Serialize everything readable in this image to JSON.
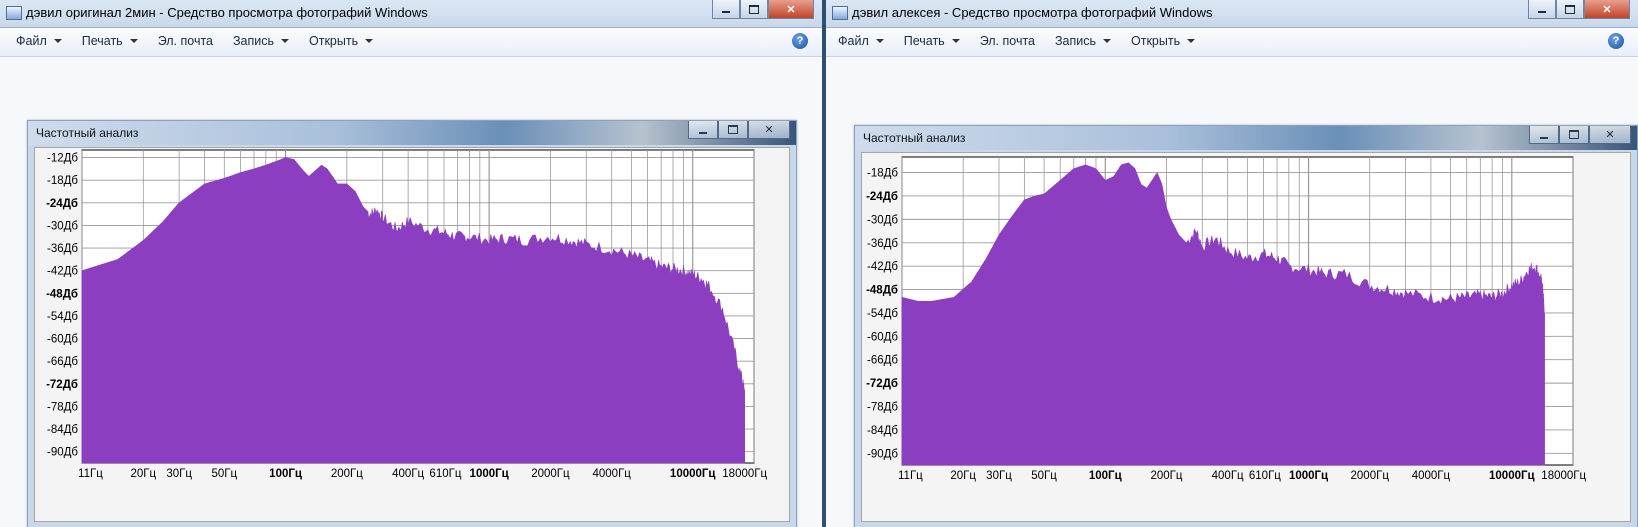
{
  "left_window": {
    "title": "дэвил оригинал 2мин - Средство просмотра фотографий Windows",
    "menu": [
      {
        "label": "Файл",
        "dropdown": true
      },
      {
        "label": "Печать",
        "dropdown": true
      },
      {
        "label": "Эл. почта",
        "dropdown": false
      },
      {
        "label": "Запись",
        "dropdown": true
      },
      {
        "label": "Открыть",
        "dropdown": true
      }
    ],
    "help": "?",
    "dialog_title": "Частотный анализ"
  },
  "right_window": {
    "title": "дэвил алексея - Средство просмотра фотографий Windows",
    "menu": [
      {
        "label": "Файл",
        "dropdown": true
      },
      {
        "label": "Печать",
        "dropdown": true
      },
      {
        "label": "Эл. почта",
        "dropdown": false
      },
      {
        "label": "Запись",
        "dropdown": true
      },
      {
        "label": "Открыть",
        "dropdown": true
      }
    ],
    "help": "?",
    "dialog_title": "Частотный анализ"
  },
  "colors": {
    "fill": "#8b3fc0",
    "grid": "#9a9a9a",
    "plot_bg": "#ffffff"
  },
  "chart_data": [
    {
      "type": "area",
      "title": "",
      "xscale": "log",
      "xlabel": "",
      "ylabel": "",
      "yticks": [
        {
          "label": "-12Дб",
          "value": -12,
          "bold": false
        },
        {
          "label": "-18Дб",
          "value": -18,
          "bold": false
        },
        {
          "label": "-24Дб",
          "value": -24,
          "bold": true
        },
        {
          "label": "-30Дб",
          "value": -30,
          "bold": false
        },
        {
          "label": "-36Дб",
          "value": -36,
          "bold": false
        },
        {
          "label": "-42Дб",
          "value": -42,
          "bold": false
        },
        {
          "label": "-48Дб",
          "value": -48,
          "bold": true
        },
        {
          "label": "-54Дб",
          "value": -54,
          "bold": false
        },
        {
          "label": "-60Дб",
          "value": -60,
          "bold": false
        },
        {
          "label": "-66Дб",
          "value": -66,
          "bold": false
        },
        {
          "label": "-72Дб",
          "value": -72,
          "bold": true
        },
        {
          "label": "-78Дб",
          "value": -78,
          "bold": false
        },
        {
          "label": "-84Дб",
          "value": -84,
          "bold": false
        },
        {
          "label": "-90Дб",
          "value": -90,
          "bold": false
        }
      ],
      "xticks": [
        {
          "label": "11Гц",
          "value": 11,
          "bold": false
        },
        {
          "label": "20Гц",
          "value": 20,
          "bold": false
        },
        {
          "label": "30Гц",
          "value": 30,
          "bold": false
        },
        {
          "label": "50Гц",
          "value": 50,
          "bold": false
        },
        {
          "label": "100Гц",
          "value": 100,
          "bold": true
        },
        {
          "label": "200Гц",
          "value": 200,
          "bold": false
        },
        {
          "label": "400Гц",
          "value": 400,
          "bold": false
        },
        {
          "label": "610Гц",
          "value": 610,
          "bold": false
        },
        {
          "label": "1000Гц",
          "value": 1000,
          "bold": true
        },
        {
          "label": "2000Гц",
          "value": 2000,
          "bold": false
        },
        {
          "label": "4000Гц",
          "value": 4000,
          "bold": false
        },
        {
          "label": "10000Гц",
          "value": 10000,
          "bold": true
        },
        {
          "label": "18000Гц",
          "value": 18000,
          "bold": false
        }
      ],
      "xlim": [
        10,
        20000
      ],
      "ylim": [
        -93,
        -10
      ],
      "series": [
        {
          "x": [
            10,
            15,
            20,
            25,
            30,
            40,
            50,
            60,
            70,
            80,
            90,
            95,
            100,
            110,
            120,
            130,
            140,
            150,
            160,
            170,
            180,
            200,
            220,
            240,
            260,
            280,
            300,
            350,
            400,
            500,
            600,
            700,
            800,
            1000,
            1200,
            1500,
            2000,
            2500,
            3000,
            4000,
            5000,
            6000,
            7000,
            8000,
            9000,
            10000,
            11000,
            12000,
            14000,
            16000,
            17500,
            18000
          ],
          "values": [
            -42,
            -39,
            -34,
            -29,
            -24,
            -19,
            -17.5,
            -16,
            -15,
            -14,
            -13,
            -12.5,
            -12,
            -12.5,
            -15,
            -17,
            -15.5,
            -14,
            -15,
            -17,
            -19,
            -19,
            -21,
            -25,
            -27,
            -26,
            -28,
            -31,
            -29,
            -31,
            -32,
            -33,
            -33,
            -34,
            -33.5,
            -34,
            -33,
            -34,
            -35,
            -36.5,
            -38,
            -39.5,
            -41,
            -41.5,
            -42,
            -43,
            -44,
            -46,
            -52,
            -63,
            -71,
            -74
          ]
        }
      ]
    },
    {
      "type": "area",
      "title": "",
      "xscale": "log",
      "xlabel": "",
      "ylabel": "",
      "yticks": [
        {
          "label": "-18Дб",
          "value": -18,
          "bold": false
        },
        {
          "label": "-24Дб",
          "value": -24,
          "bold": true
        },
        {
          "label": "-30Дб",
          "value": -30,
          "bold": false
        },
        {
          "label": "-36Дб",
          "value": -36,
          "bold": false
        },
        {
          "label": "-42Дб",
          "value": -42,
          "bold": false
        },
        {
          "label": "-48Дб",
          "value": -48,
          "bold": true
        },
        {
          "label": "-54Дб",
          "value": -54,
          "bold": false
        },
        {
          "label": "-60Дб",
          "value": -60,
          "bold": false
        },
        {
          "label": "-66Дб",
          "value": -66,
          "bold": false
        },
        {
          "label": "-72Дб",
          "value": -72,
          "bold": true
        },
        {
          "label": "-78Дб",
          "value": -78,
          "bold": false
        },
        {
          "label": "-84Дб",
          "value": -84,
          "bold": false
        },
        {
          "label": "-90Дб",
          "value": -90,
          "bold": false
        }
      ],
      "xticks": [
        {
          "label": "11Гц",
          "value": 11,
          "bold": false
        },
        {
          "label": "20Гц",
          "value": 20,
          "bold": false
        },
        {
          "label": "30Гц",
          "value": 30,
          "bold": false
        },
        {
          "label": "50Гц",
          "value": 50,
          "bold": false
        },
        {
          "label": "100Гц",
          "value": 100,
          "bold": true
        },
        {
          "label": "200Гц",
          "value": 200,
          "bold": false
        },
        {
          "label": "400Гц",
          "value": 400,
          "bold": false
        },
        {
          "label": "610Гц",
          "value": 610,
          "bold": false
        },
        {
          "label": "1000Гц",
          "value": 1000,
          "bold": true
        },
        {
          "label": "2000Гц",
          "value": 2000,
          "bold": false
        },
        {
          "label": "4000Гц",
          "value": 4000,
          "bold": false
        },
        {
          "label": "10000Гц",
          "value": 10000,
          "bold": true
        },
        {
          "label": "18000Гц",
          "value": 18000,
          "bold": false
        }
      ],
      "xlim": [
        10,
        20000
      ],
      "ylim": [
        -93,
        -14
      ],
      "series": [
        {
          "x": [
            10,
            12,
            14,
            18,
            22,
            26,
            30,
            35,
            40,
            45,
            50,
            60,
            70,
            80,
            90,
            100,
            110,
            120,
            130,
            140,
            150,
            160,
            170,
            180,
            190,
            200,
            210,
            230,
            250,
            280,
            300,
            350,
            400,
            500,
            600,
            700,
            800,
            1000,
            1200,
            1500,
            2000,
            2500,
            3000,
            4000,
            5000,
            6000,
            7000,
            8000,
            9000,
            10000,
            11000,
            12000,
            13000,
            14000,
            14500
          ],
          "values": [
            -50,
            -51,
            -51,
            -50,
            -46,
            -40,
            -34,
            -29,
            -25,
            -24,
            -23.5,
            -20,
            -17,
            -16,
            -17,
            -20,
            -19,
            -16,
            -15.5,
            -17,
            -21,
            -22,
            -20,
            -18,
            -21,
            -27,
            -30,
            -34,
            -36,
            -33,
            -37,
            -35,
            -38,
            -40,
            -39,
            -40,
            -42,
            -43,
            -44,
            -44,
            -47,
            -48,
            -49,
            -50,
            -50.5,
            -50,
            -49.5,
            -50,
            -49,
            -47,
            -46,
            -43,
            -42,
            -45,
            -54
          ]
        }
      ]
    }
  ]
}
